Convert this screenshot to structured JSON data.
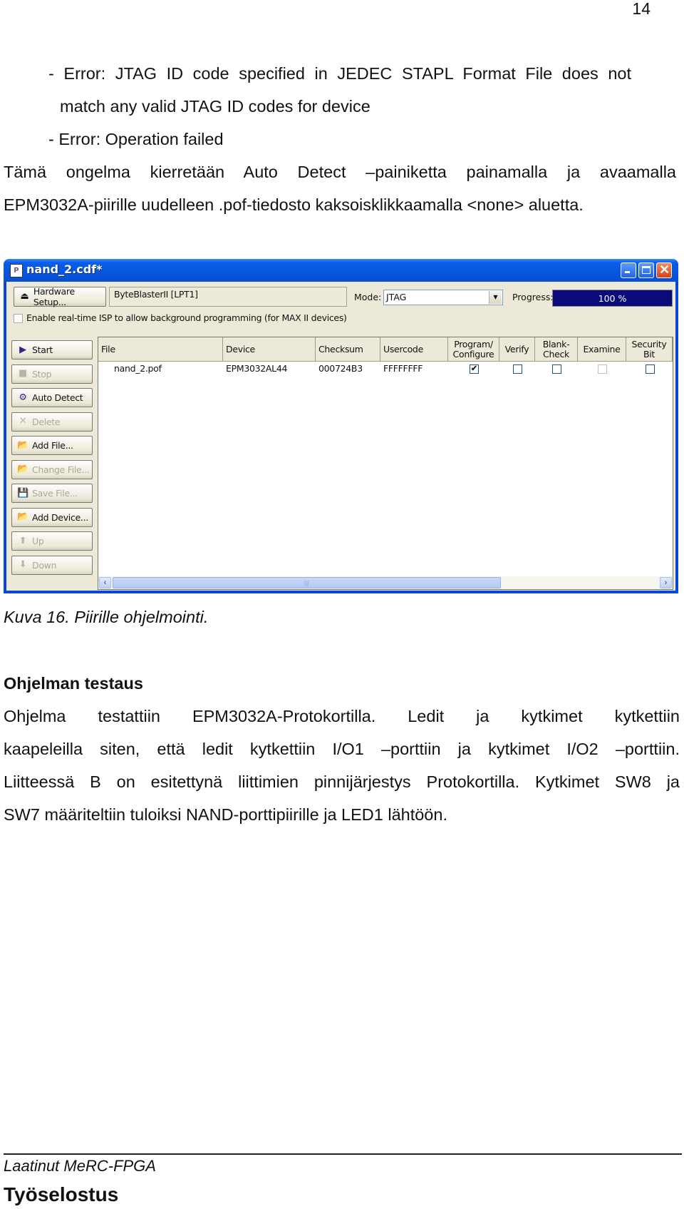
{
  "page": {
    "number": "14",
    "intro_lines": [
      {
        "text": "- Error: JTAG ID code specified in JEDEC STAPL Format File does not",
        "justify": true
      },
      {
        "text": "match any valid JTAG ID codes for device",
        "justify": false
      },
      {
        "text": "- Error: Operation failed",
        "justify": false
      },
      {
        "text": "Tämä ongelma kierretään Auto Detect –painiketta painamalla ja avaamalla",
        "justify": true
      },
      {
        "text": "EPM3032A-piirille uudelleen .pof-tiedosto kaksoisklikkaamalla <none> aluetta.",
        "justify": false
      }
    ],
    "caption": "Kuva 16. Piirille ohjelmointi.",
    "section_heading": "Ohjelman testaus",
    "body_lines": [
      {
        "text": "Ohjelma testattiin EPM3032A-Protokortilla. Ledit ja kytkimet kytkettiin",
        "justify": true
      },
      {
        "text": "kaapeleilla siten, että ledit kytkettiin I/O1 –porttiin ja kytkimet I/O2 –porttiin.",
        "justify": true
      },
      {
        "text": "Liitteessä B on esitettynä liittimien pinnijärjestys Protokortilla. Kytkimet SW8 ja",
        "justify": true
      },
      {
        "text": "SW7 määriteltiin tuloiksi NAND-porttipiirille ja LED1 lähtöön.",
        "justify": false
      }
    ],
    "footer": {
      "author": "Laatinut MeRC-FPGA",
      "doc_title": "Työselostus"
    }
  },
  "window": {
    "title": "nand_2.cdf*",
    "title_icon": "programmer-icon",
    "hardware_setup_label": "Hardware Setup...",
    "hardware_value": "ByteBlasterII [LPT1]",
    "mode_label": "Mode:",
    "mode_value": "JTAG",
    "progress_label": "Progress:",
    "progress_text": "100 %",
    "progress_percent": 100,
    "isp_checkbox_label": "Enable real-time ISP to allow background programming (for MAX II devices)",
    "isp_checked": false,
    "side_buttons": [
      {
        "label": "Start",
        "icon": "start-icon",
        "glyph": "▶",
        "enabled": true
      },
      {
        "label": "Stop",
        "icon": "stop-icon",
        "glyph": "■",
        "enabled": false
      },
      {
        "label": "Auto Detect",
        "icon": "auto-detect-icon",
        "glyph": "⚙",
        "enabled": true
      },
      {
        "label": "Delete",
        "icon": "delete-icon",
        "glyph": "✕",
        "enabled": false
      },
      {
        "label": "Add File...",
        "icon": "add-file-icon",
        "glyph": "📂",
        "enabled": true
      },
      {
        "label": "Change File...",
        "icon": "change-file-icon",
        "glyph": "📂",
        "enabled": false
      },
      {
        "label": "Save File...",
        "icon": "save-file-icon",
        "glyph": "💾",
        "enabled": false
      },
      {
        "label": "Add Device...",
        "icon": "add-device-icon",
        "glyph": "📂",
        "enabled": true
      },
      {
        "label": "Up",
        "icon": "up-arrow-icon",
        "glyph": "⬆",
        "enabled": false
      },
      {
        "label": "Down",
        "icon": "down-arrow-icon",
        "glyph": "⬇",
        "enabled": false
      }
    ],
    "columns": [
      "File",
      "Device",
      "Checksum",
      "Usercode",
      "Program/ Configure",
      "Verify",
      "Blank- Check",
      "Examine",
      "Security Bit"
    ],
    "rows": [
      {
        "file": "nand_2.pof",
        "device": "EPM3032AL44",
        "checksum": "000724B3",
        "usercode": "FFFFFFFF",
        "program_configure": true,
        "verify": false,
        "blank_check": false,
        "examine": false,
        "examine_enabled": false,
        "security_bit": false
      }
    ],
    "colors": {
      "titlebar": "#0a5ee8",
      "progress_fill": "#0a0a7a",
      "window_face": "#ece9d8"
    }
  }
}
